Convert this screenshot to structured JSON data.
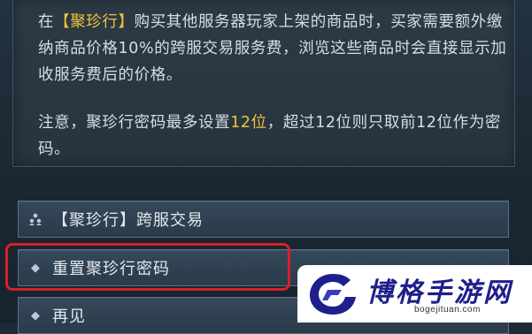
{
  "info": {
    "para1": {
      "prefix": "在",
      "npc": "【聚珍行】",
      "rest": "购买其他服务器玩家上架的商品时，买家需要额外缴纳商品价格10%的跨服交易服务费，浏览这些商品时会直接显示加收服务费后的价格。"
    },
    "para2": {
      "prefix": "注意，聚珍行密码最多设置",
      "limit": "12位",
      "rest": "，超过12位则只取前12位作为密码。"
    }
  },
  "menu": {
    "items": [
      {
        "label": "【聚珍行】跨服交易",
        "icon": "people-icon"
      },
      {
        "label": "重置聚珍行密码",
        "icon": "diamond-bullet-icon"
      },
      {
        "label": "再见",
        "icon": "diamond-bullet-icon"
      }
    ]
  },
  "highlight": {
    "color": "#d4212c"
  },
  "watermark": {
    "title": "博格手游网",
    "url": "bogejituan.com",
    "color": "#1e1f8c"
  },
  "colors": {
    "accent": "#f0c23a",
    "text": "#d9dde0"
  }
}
